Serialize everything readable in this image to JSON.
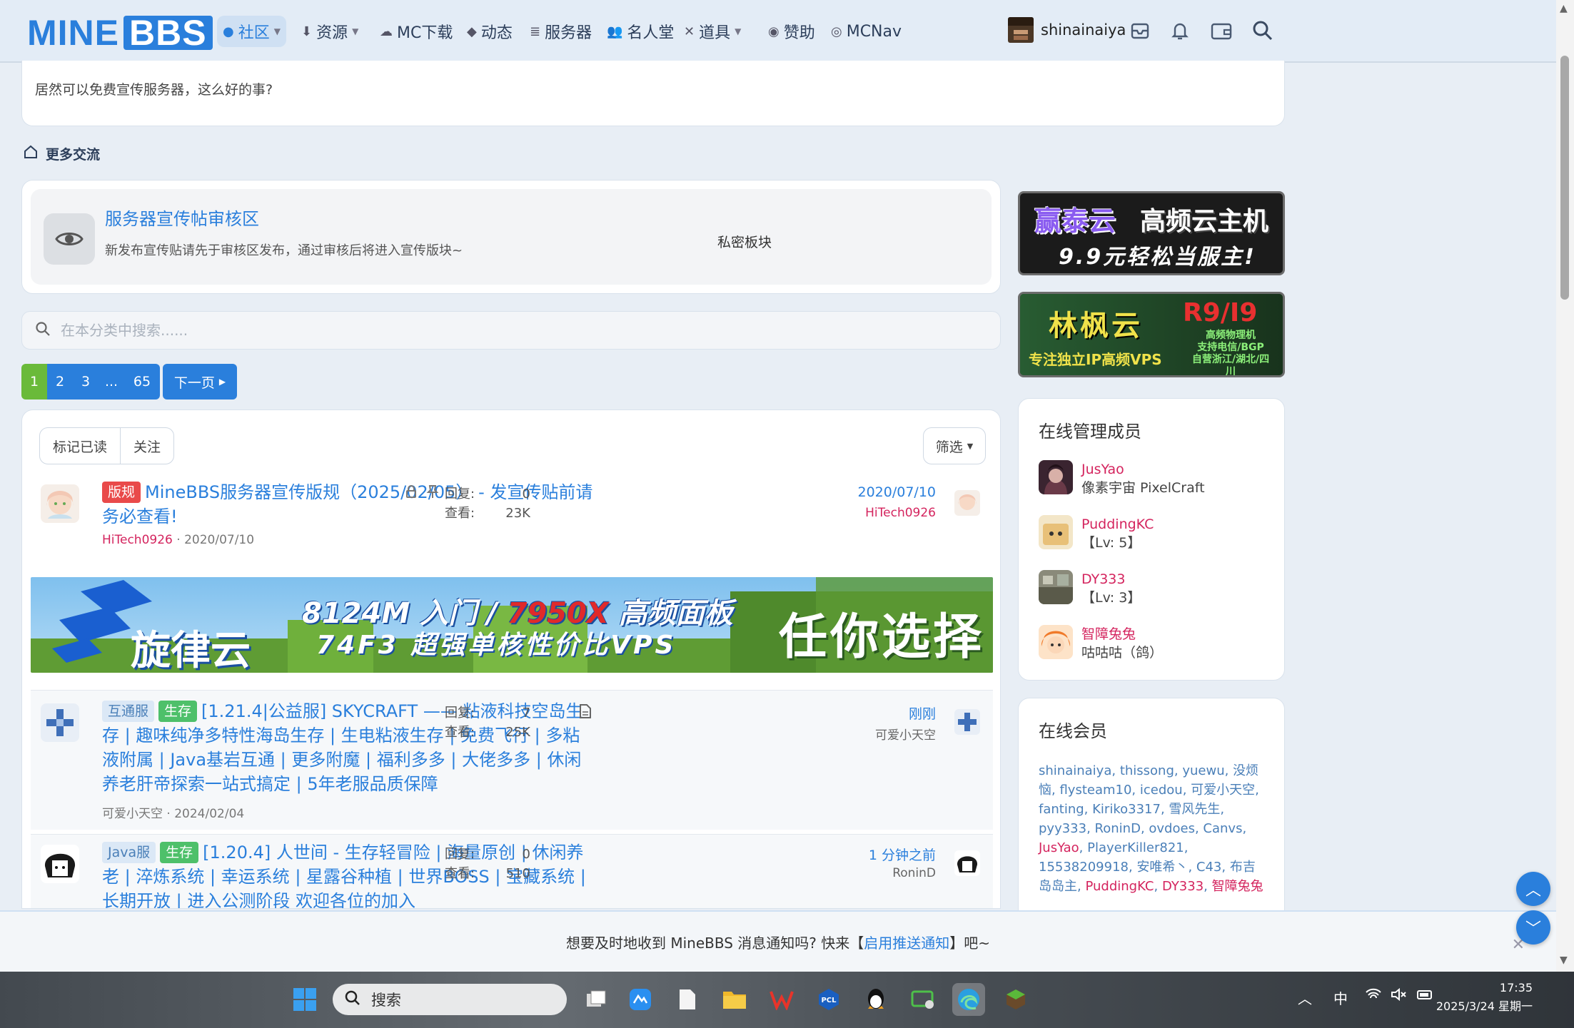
{
  "nav": {
    "logo_mine": "MINE",
    "logo_bbs": "BBS",
    "items": [
      {
        "label": "社区",
        "icon": "chat-icon"
      },
      {
        "label": "资源",
        "icon": "download-icon"
      },
      {
        "label": "MC下载",
        "icon": "cloud-icon"
      },
      {
        "label": "动态",
        "icon": "handshake-icon"
      },
      {
        "label": "服务器",
        "icon": "server-icon"
      },
      {
        "label": "名人堂",
        "icon": "people-icon"
      },
      {
        "label": "道具",
        "icon": "tools-icon"
      },
      {
        "label": "赞助",
        "icon": "sponsor-icon"
      },
      {
        "label": "MCNav",
        "icon": "compass-icon"
      }
    ],
    "username": "shinainaiya"
  },
  "top_card": {
    "text": "居然可以免费宣传服务器，这么好的事?"
  },
  "section": {
    "title": "更多交流"
  },
  "subforum": {
    "title": "服务器宣传帖审核区",
    "desc": "新发布宣传贴请先于审核区发布，通过审核后将进入宣传版块~",
    "tag": "私密板块"
  },
  "search": {
    "placeholder": "在本分类中搜索......"
  },
  "pager": {
    "pages": [
      "1",
      "2",
      "3",
      "...",
      "65"
    ],
    "next": "下一页"
  },
  "list_controls": {
    "mark_read": "标记已读",
    "follow": "关注",
    "filter": "筛选"
  },
  "threads": [
    {
      "badges": [
        "版规"
      ],
      "title": "MineBBS服务器宣传版规（2025/02/05） - 发宣传贴前请务必查看!",
      "author": "HiTech0926",
      "date": "2020/07/10",
      "reply_label": "回复:",
      "view_label": "查看:",
      "replies": "0",
      "views": "23K",
      "last_time": "2020/07/10",
      "last_user": "HiTech0926"
    },
    {
      "badges": [
        "互通服",
        "生存"
      ],
      "title": "[1.21.4|公益服] SKYCRAFT —— 粘液科技空岛生存 | 趣味纯净多特性海岛生存 | 生电粘液生存 | 免费飞行 | 多粘液附属 | Java基岩互通 | 更多附魔 | 福利多多 | 大佬多多 | 休闲养老肝帝探索一站式搞定 | 5年老服品质保障",
      "author": "可爱小天空",
      "date": "2024/02/04",
      "reply_label": "回复:",
      "view_label": "查看:",
      "replies": "7",
      "views": "25K",
      "last_time": "刚刚",
      "last_user": "可爱小天空"
    },
    {
      "badges": [
        "Java服",
        "生存"
      ],
      "title": "[1.20.4] 人世间 - 生存轻冒险 | 海量原创 | 休闲养老 | 淬炼系统 | 幸运系统 | 星露谷种植 | 世界BOSS | 宝藏系统 | 长期开放 | 进入公测阶段 欢迎各位的加入",
      "author": "",
      "date": "",
      "reply_label": "回复:",
      "view_label": "查看:",
      "replies": "0",
      "views": "510",
      "last_time": "1 分钟之前",
      "last_user": "RoninD"
    }
  ],
  "banner": {
    "brand": "旋律云",
    "line1a": "8124M 入门 / ",
    "line1b": "7950X",
    "line1c": " 高频面板",
    "line2": "74F3 超强单核性价比VPS",
    "slogan": "任你选择"
  },
  "ads": [
    {
      "line1a": "赢泰云",
      "line1b": "高频云主机",
      "line2": "9.9元轻松当服主!"
    },
    {
      "brand": "林枫云",
      "model": "R9/I9",
      "sub1": "高频物理机",
      "sub2": "支持电信/BGP",
      "sub3": "自营浙江/湖北/四川",
      "tagline": "专注独立IP高频VPS"
    }
  ],
  "staff": {
    "title": "在线管理成员",
    "members": [
      {
        "name": "JusYao",
        "role": "像素宇宙 PixelCraft"
      },
      {
        "name": "PuddingKC",
        "role": "【Lv: 5】"
      },
      {
        "name": "DY333",
        "role": "【Lv: 3】"
      },
      {
        "name": "智障兔兔",
        "role": "咕咕咕（鸽）"
      }
    ]
  },
  "online": {
    "title": "在线会员",
    "names": [
      "shinainaiya",
      "thissong",
      "yuewu",
      "没烦恼",
      "flysteam10",
      "icedou",
      "可爱小天空",
      "fanting",
      "Kiriko3317",
      "雪风先生",
      "pyy333",
      "RoninD",
      "ovdoes",
      "Canvs",
      "JusYao",
      "PlayerKiller821",
      "15538209918",
      "安唯希丶",
      "C43",
      "布吉岛岛主",
      "PuddingKC",
      "DY333",
      "智障兔兔"
    ],
    "staff_names": [
      "JusYao",
      "PuddingKC",
      "DY333",
      "智障兔兔"
    ]
  },
  "notice": {
    "pre": "想要及时地收到 MineBBS 消息通知吗? 快来【",
    "link": "启用推送通知",
    "post": "】吧~"
  },
  "taskbar": {
    "search_placeholder": "搜索",
    "tray_lang": "中",
    "time": "17:35",
    "date": "2025/3/24 星期一"
  }
}
